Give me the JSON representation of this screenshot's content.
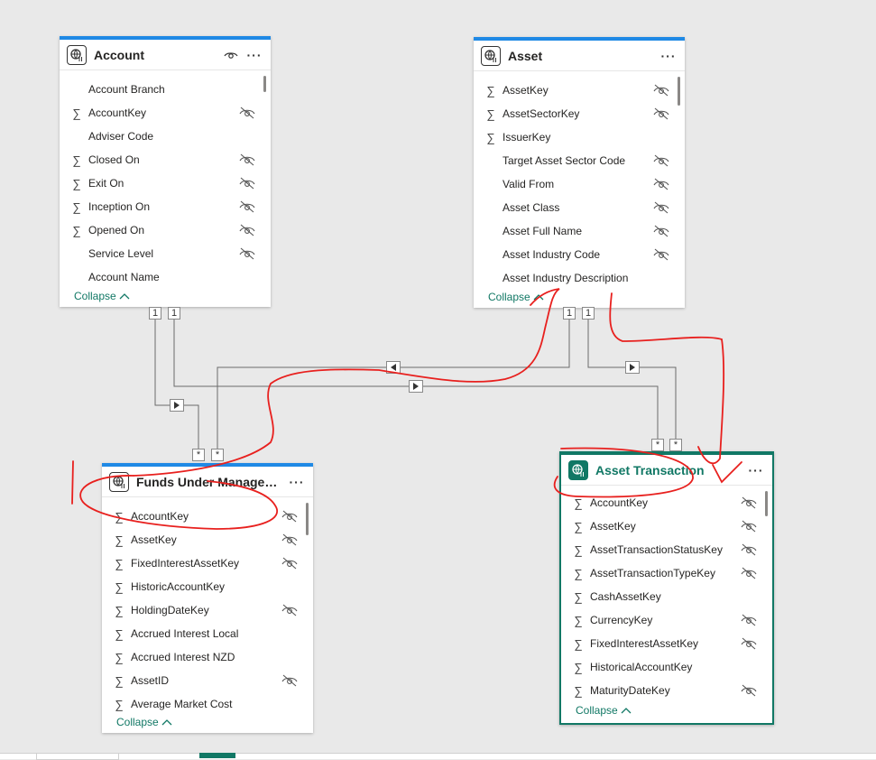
{
  "tables": {
    "account": {
      "title": "Account",
      "fields": [
        {
          "name": "Account Branch",
          "sum": false,
          "hidden": false
        },
        {
          "name": "AccountKey",
          "sum": true,
          "hidden": true
        },
        {
          "name": "Adviser Code",
          "sum": false,
          "hidden": false
        },
        {
          "name": "Closed On",
          "sum": true,
          "hidden": true
        },
        {
          "name": "Exit On",
          "sum": true,
          "hidden": true
        },
        {
          "name": "Inception On",
          "sum": true,
          "hidden": true
        },
        {
          "name": "Opened On",
          "sum": true,
          "hidden": true
        },
        {
          "name": "Service Level",
          "sum": false,
          "hidden": true
        },
        {
          "name": "Account Name",
          "sum": false,
          "hidden": false
        }
      ],
      "collapse_label": "Collapse"
    },
    "asset": {
      "title": "Asset",
      "fields": [
        {
          "name": "AssetKey",
          "sum": true,
          "hidden": true
        },
        {
          "name": "AssetSectorKey",
          "sum": true,
          "hidden": true
        },
        {
          "name": "IssuerKey",
          "sum": true,
          "hidden": false
        },
        {
          "name": "Target Asset Sector Code",
          "sum": false,
          "hidden": true
        },
        {
          "name": "Valid From",
          "sum": false,
          "hidden": true
        },
        {
          "name": "Asset Class",
          "sum": false,
          "hidden": true
        },
        {
          "name": "Asset Full Name",
          "sum": false,
          "hidden": true
        },
        {
          "name": "Asset Industry Code",
          "sum": false,
          "hidden": true
        },
        {
          "name": "Asset Industry Description",
          "sum": false,
          "hidden": false
        }
      ],
      "collapse_label": "Collapse"
    },
    "fum": {
      "title": "Funds Under Managem...",
      "fields": [
        {
          "name": "AccountKey",
          "sum": true,
          "hidden": true
        },
        {
          "name": "AssetKey",
          "sum": true,
          "hidden": true
        },
        {
          "name": "FixedInterestAssetKey",
          "sum": true,
          "hidden": true
        },
        {
          "name": "HistoricAccountKey",
          "sum": true,
          "hidden": false
        },
        {
          "name": "HoldingDateKey",
          "sum": true,
          "hidden": true
        },
        {
          "name": "Accrued Interest Local",
          "sum": true,
          "hidden": false
        },
        {
          "name": "Accrued Interest NZD",
          "sum": true,
          "hidden": false
        },
        {
          "name": "AssetID",
          "sum": true,
          "hidden": true
        },
        {
          "name": "Average Market Cost",
          "sum": true,
          "hidden": false
        }
      ],
      "collapse_label": "Collapse"
    },
    "asset_transaction": {
      "title": "Asset Transaction",
      "fields": [
        {
          "name": "AccountKey",
          "sum": true,
          "hidden": true
        },
        {
          "name": "AssetKey",
          "sum": true,
          "hidden": true
        },
        {
          "name": "AssetTransactionStatusKey",
          "sum": true,
          "hidden": true
        },
        {
          "name": "AssetTransactionTypeKey",
          "sum": true,
          "hidden": true
        },
        {
          "name": "CashAssetKey",
          "sum": true,
          "hidden": false
        },
        {
          "name": "CurrencyKey",
          "sum": true,
          "hidden": true
        },
        {
          "name": "FixedInterestAssetKey",
          "sum": true,
          "hidden": true
        },
        {
          "name": "HistoricalAccountKey",
          "sum": true,
          "hidden": false
        },
        {
          "name": "MaturityDateKey",
          "sum": true,
          "hidden": true
        }
      ],
      "collapse_label": "Collapse"
    }
  },
  "cardinality": {
    "one": "1",
    "many": "*"
  },
  "icons": {
    "table": "table-model-icon",
    "view": "eye-icon",
    "more": "more-options-icon",
    "hidden": "eye-hidden-icon",
    "sum": "sigma-icon",
    "collapse": "chevron-up-icon",
    "filter_direction": "filter-direction-icon"
  },
  "colors": {
    "canvas": "#e9e9e9",
    "card_accent": "#1f89e5",
    "selected_accent": "#117865",
    "annotation": "#e8201e"
  }
}
